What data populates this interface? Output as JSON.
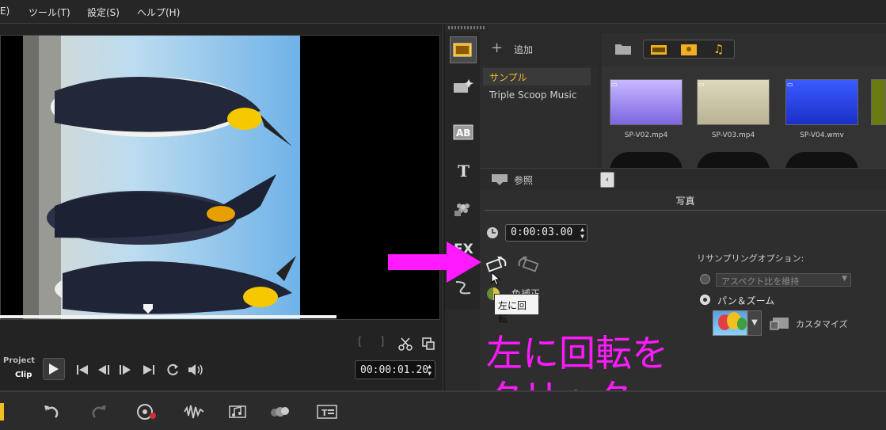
{
  "menu": {
    "items": [
      "E)",
      "ツール(T)",
      "設定(S)",
      "ヘルプ(H)"
    ]
  },
  "preview": {
    "mode_project": "Project",
    "mode_clip": "Clip",
    "timecode": "00:00:01.20"
  },
  "library": {
    "add_label": "追加",
    "folders": [
      "サンプル",
      "Triple Scoop Music"
    ],
    "thumbnails": [
      {
        "name": "SP-V02.mp4",
        "color": "#9d87f0"
      },
      {
        "name": "SP-V03.mp4",
        "color": "#cfc9a8"
      },
      {
        "name": "SP-V04.wmv",
        "color": "#2a45e6"
      }
    ],
    "browse_label": "参照"
  },
  "options": {
    "title": "写真",
    "duration": "0:00:03.00",
    "color_correction_label": "色補正",
    "tooltip": "左に回転",
    "resample_label": "リサンプリングオプション:",
    "aspect_option": "アスペクト比を維持",
    "pan_zoom_option": "パン＆ズーム",
    "customize_label": "カスタマイズ"
  },
  "annotation": {
    "line1": "左に回転を",
    "line2": "クリック",
    "color": "#ff1aff"
  },
  "colors": {
    "accent": "#f0c020",
    "highlight_row": "#3a3a3a"
  }
}
